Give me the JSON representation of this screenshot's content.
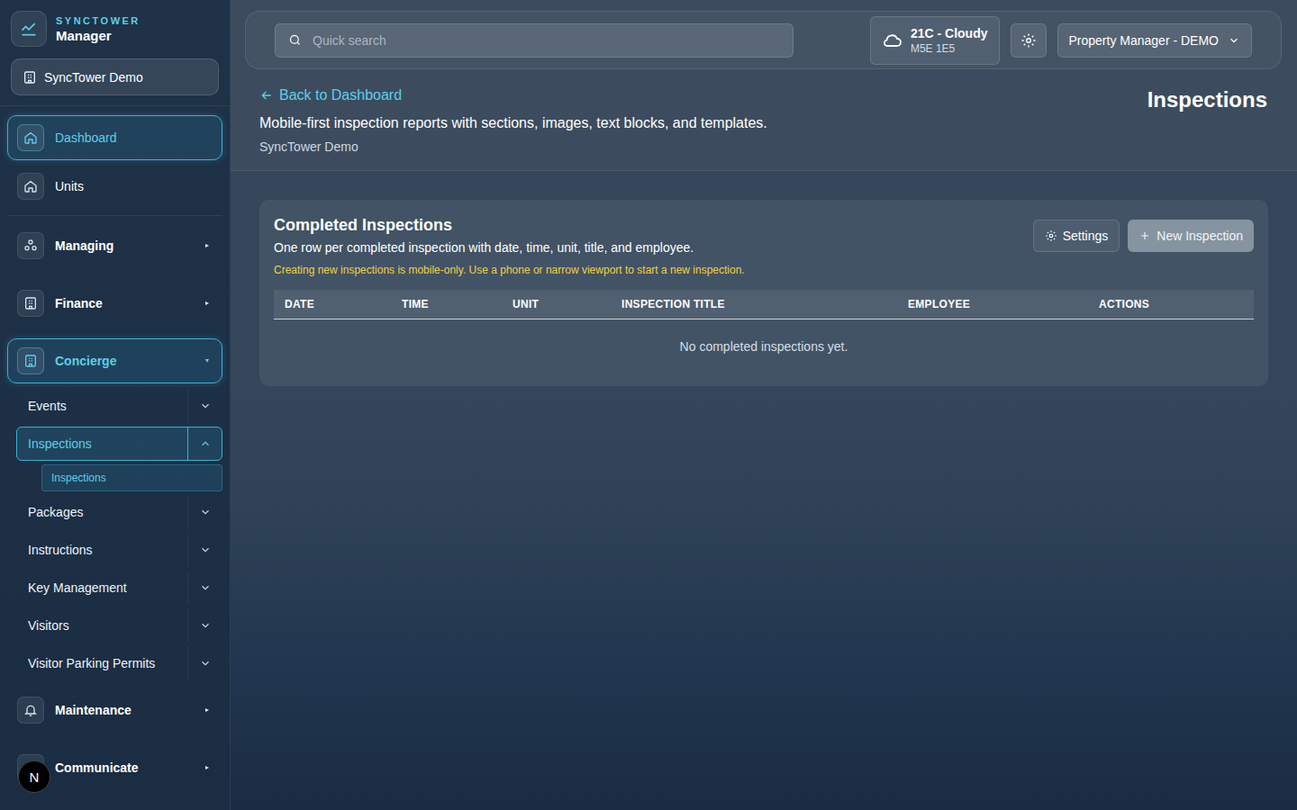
{
  "brand": {
    "eyebrow": "SYNCTOWER",
    "name": "Manager"
  },
  "property": {
    "name": "SyncTower Demo"
  },
  "nav": [
    {
      "label": "Dashboard",
      "kind": "link",
      "selected": true
    },
    {
      "label": "Units",
      "kind": "link",
      "selected": false
    },
    {
      "label": "Managing",
      "kind": "section",
      "selected": false,
      "expanded": false,
      "children": []
    },
    {
      "label": "Finance",
      "kind": "section",
      "selected": false,
      "expanded": false,
      "children": []
    },
    {
      "label": "Concierge",
      "kind": "section",
      "selected": true,
      "expanded": true,
      "children": [
        {
          "label": "Events",
          "selected": false,
          "expanded": false,
          "children": []
        },
        {
          "label": "Inspections",
          "selected": true,
          "expanded": true,
          "children": [
            {
              "label": "Inspections",
              "selected": true
            }
          ]
        },
        {
          "label": "Packages",
          "selected": false,
          "expanded": false,
          "children": []
        },
        {
          "label": "Instructions",
          "selected": false,
          "expanded": false,
          "children": []
        },
        {
          "label": "Key Management",
          "selected": false,
          "expanded": false,
          "children": []
        },
        {
          "label": "Visitors",
          "selected": false,
          "expanded": false,
          "children": []
        },
        {
          "label": "Visitor Parking Permits",
          "selected": false,
          "expanded": false,
          "children": []
        }
      ]
    },
    {
      "label": "Maintenance",
      "kind": "section",
      "selected": false,
      "expanded": false,
      "children": []
    },
    {
      "label": "Communicate",
      "kind": "section",
      "selected": false,
      "expanded": false,
      "children": []
    }
  ],
  "dev_badge": "N",
  "topbar": {
    "search_placeholder": "Quick search",
    "weather": {
      "reading": "21C - Cloudy",
      "postal": "M5E 1E5"
    },
    "user": "Property Manager - DEMO"
  },
  "header": {
    "back": "Back to Dashboard",
    "title": "Inspections",
    "subtitle": "Mobile-first inspection reports with sections, images, text blocks, and templates.",
    "org": "SyncTower Demo"
  },
  "card": {
    "title": "Completed Inspections",
    "description": "One row per completed inspection with date, time, unit, title, and employee.",
    "notice": "Creating new inspections is mobile-only. Use a phone or narrow viewport to start a new inspection.",
    "buttons": [
      {
        "label": "Settings",
        "kind": "settings",
        "disabled": false
      },
      {
        "label": "New Inspection",
        "kind": "new",
        "disabled": true
      }
    ]
  },
  "table": {
    "columns": [
      "DATE",
      "TIME",
      "UNIT",
      "INSPECTION TITLE",
      "EMPLOYEE",
      "ACTIONS"
    ],
    "rows": [],
    "empty": "No completed inspections yet."
  }
}
